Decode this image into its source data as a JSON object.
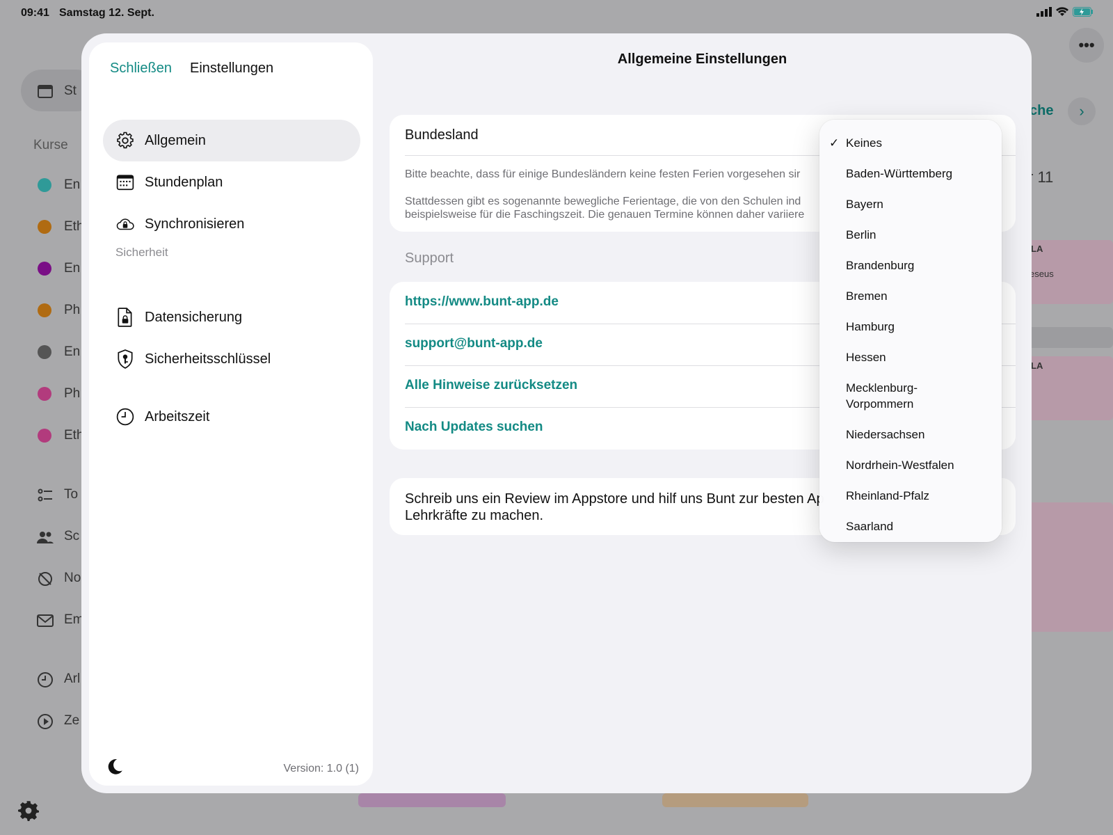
{
  "status": {
    "time": "09:41",
    "date": "Samstag 12. Sept."
  },
  "background": {
    "pill_label": "St",
    "courses_heading": "Kurse",
    "courses": [
      {
        "label": "En",
        "color": "#2f9a98"
      },
      {
        "label": "Eth",
        "color": "#b06b12"
      },
      {
        "label": "En",
        "color": "#7a0f86"
      },
      {
        "label": "Ph",
        "color": "#b06b12"
      },
      {
        "label": "En",
        "color": "#555555"
      },
      {
        "label": "Ph",
        "color": "#b23b7d"
      },
      {
        "label": "Eth",
        "color": "#b23b7d"
      }
    ],
    "tools": [
      "To",
      "Sc",
      "No",
      "Em"
    ],
    "extra": [
      "Arl",
      "Ze"
    ],
    "week_label": "che",
    "day_number": "r 11",
    "lesson_a": "LA",
    "lesson_a_sub": "eseus",
    "lesson_b": "LA"
  },
  "sidebar": {
    "close_label": "Schließen",
    "title": "Einstellungen",
    "items": [
      {
        "label": "Allgemein",
        "icon": "gear-icon"
      },
      {
        "label": "Stundenplan",
        "icon": "calendar-icon"
      },
      {
        "label": "Synchronisieren",
        "icon": "cloud-lock-icon"
      }
    ],
    "security_heading": "Sicherheit",
    "security_items": [
      {
        "label": "Datensicherung",
        "icon": "document-lock-icon"
      },
      {
        "label": "Sicherheitsschlüssel",
        "icon": "shield-key-icon"
      }
    ],
    "work_item": {
      "label": "Arbeitszeit",
      "icon": "clock-icon"
    },
    "version": "Version: 1.0 (1)"
  },
  "main": {
    "title": "Allgemeine Einstellungen",
    "state_label": "Bundesland",
    "note_line1": "Bitte beachte, dass für einige Bundesländern keine festen Ferien vorgesehen sir",
    "note_line2": "Stattdessen gibt es sogenannte bewegliche Ferientage, die von den Schulen ind",
    "note_line3": "beispielsweise für die Faschingszeit. Die genauen Termine können daher variiere",
    "support_heading": "Support",
    "links": [
      "https://www.bunt-app.de",
      "support@bunt-app.de",
      "Alle Hinweise zurücksetzen",
      "Nach Updates suchen"
    ],
    "review_line1": "Schreib uns ein Review im Appstore und hilf uns Bunt zur besten Ap",
    "review_line2": "Lehrkräfte zu machen."
  },
  "dropdown": {
    "selected": "Keines",
    "options": [
      "Keines",
      "Baden-Württemberg",
      "Bayern",
      "Berlin",
      "Brandenburg",
      "Bremen",
      "Hamburg",
      "Hessen",
      "Mecklenburg-",
      "Vorpommern",
      "Niedersachsen",
      "Nordrhein-Westfalen",
      "Rheinland-Pfalz",
      "Saarland"
    ]
  },
  "colors": {
    "accent": "#138a84",
    "background": "#f2f2f6"
  }
}
